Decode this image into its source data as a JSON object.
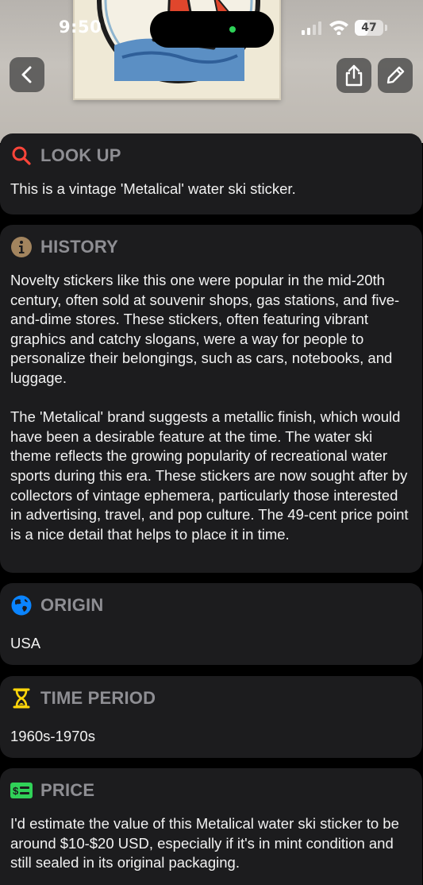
{
  "status_bar": {
    "time": "9:50",
    "battery_percent": "47",
    "battery_level": 0.47
  },
  "hero": {
    "subject": "vintage water ski sticker photo"
  },
  "nav": {
    "back_icon": "chevron-left-icon",
    "share_icon": "share-icon",
    "edit_icon": "pencil-icon"
  },
  "sections": {
    "lookup": {
      "title": "LOOK UP",
      "icon": "magnifying-glass-icon",
      "icon_color": "#ff453a",
      "text": "This is a vintage 'Metalical' water ski sticker."
    },
    "history": {
      "title": "HISTORY",
      "icon": "info-circle-icon",
      "icon_color": "#a2845e",
      "paragraphs": [
        "Novelty stickers like this one were popular in the mid-20th century, often sold at souvenir shops, gas stations, and five-and-dime stores. These stickers, often featuring vibrant graphics and catchy slogans, were a way for people to personalize their belongings, such as cars, notebooks, and luggage.",
        "The 'Metalical' brand suggests a metallic finish, which would have been a desirable feature at the time. The water ski theme reflects the growing popularity of recreational water sports during this era. These stickers are now sought after by collectors of vintage ephemera, particularly those interested in advertising, travel, and pop culture. The 49-cent price point is a nice detail that helps to place it in time."
      ]
    },
    "origin": {
      "title": "ORIGIN",
      "icon": "globe-icon",
      "icon_color": "#0a84ff",
      "text": "USA"
    },
    "time_period": {
      "title": "TIME PERIOD",
      "icon": "hourglass-icon",
      "icon_color": "#ffd60a",
      "text": "1960s-1970s"
    },
    "price": {
      "title": "PRICE",
      "icon": "dollar-bill-icon",
      "icon_color": "#30d158",
      "text": "I'd estimate the value of this Metalical water ski sticker to be around $10-$20 USD, especially if it's in mint condition and still sealed in its original packaging."
    }
  }
}
